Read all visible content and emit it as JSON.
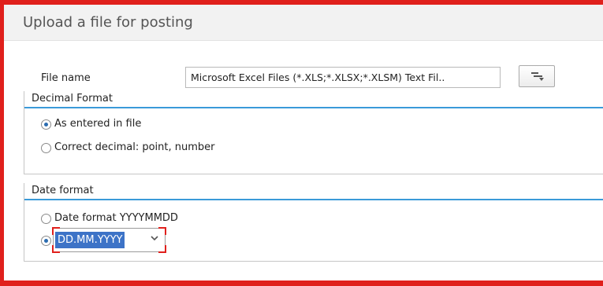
{
  "dialog": {
    "title": "Upload a file for posting"
  },
  "file": {
    "label": "File name",
    "value": "Microsoft Excel Files (*.XLS;*.XLSX;*.XLSM) Text Fil..",
    "browse_icon": "browse-icon"
  },
  "decimal_format": {
    "title": "Decimal Format",
    "options": [
      {
        "label": "As entered in file",
        "selected": true
      },
      {
        "label": "Correct decimal: point, number",
        "selected": false
      }
    ]
  },
  "date_format": {
    "title": "Date format",
    "options": [
      {
        "label": "Date format YYYYMMDD",
        "selected": false
      },
      {
        "label": "",
        "selected": true
      }
    ],
    "select_value": "DD.MM.YYYY"
  },
  "colors": {
    "highlight_border": "#e0201c",
    "group_line": "#3a9ad9",
    "selection": "#3d73c7"
  }
}
